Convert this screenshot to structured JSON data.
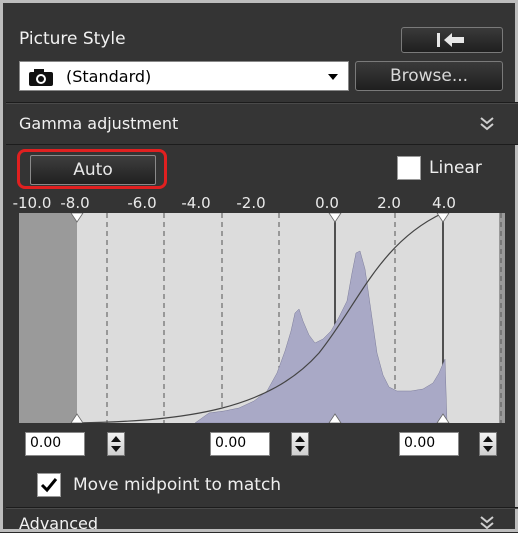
{
  "picture_style": {
    "title": "Picture Style",
    "selected_style": "(Standard)",
    "browse_label": "Browse...",
    "reset_icon": "revert-arrow-icon",
    "style_icon": "camera-icon"
  },
  "gamma": {
    "title": "Gamma adjustment",
    "collapse_icon": "double-chevron-icon",
    "auto_label": "Auto",
    "linear_label": "Linear",
    "linear_checked": false,
    "axis_ticks": [
      "-10.0",
      "-8.0",
      "-6.0",
      "-4.0",
      "-2.0",
      "0.0",
      "2.0",
      "4.0"
    ],
    "fields": [
      {
        "name": "black-point",
        "value": "0.00"
      },
      {
        "name": "midpoint",
        "value": "0.00"
      },
      {
        "name": "white-point",
        "value": "0.00"
      }
    ],
    "move_midpoint_label": "Move midpoint to match",
    "move_midpoint_checked": true,
    "colors": {
      "highlight": "#e02020",
      "histogram": "#a9a9c6",
      "graph_bg": "#dcdcdc",
      "clipped": "#9a9a9a"
    }
  },
  "advanced": {
    "title": "Advanced",
    "expand_icon": "double-chevron-icon"
  }
}
